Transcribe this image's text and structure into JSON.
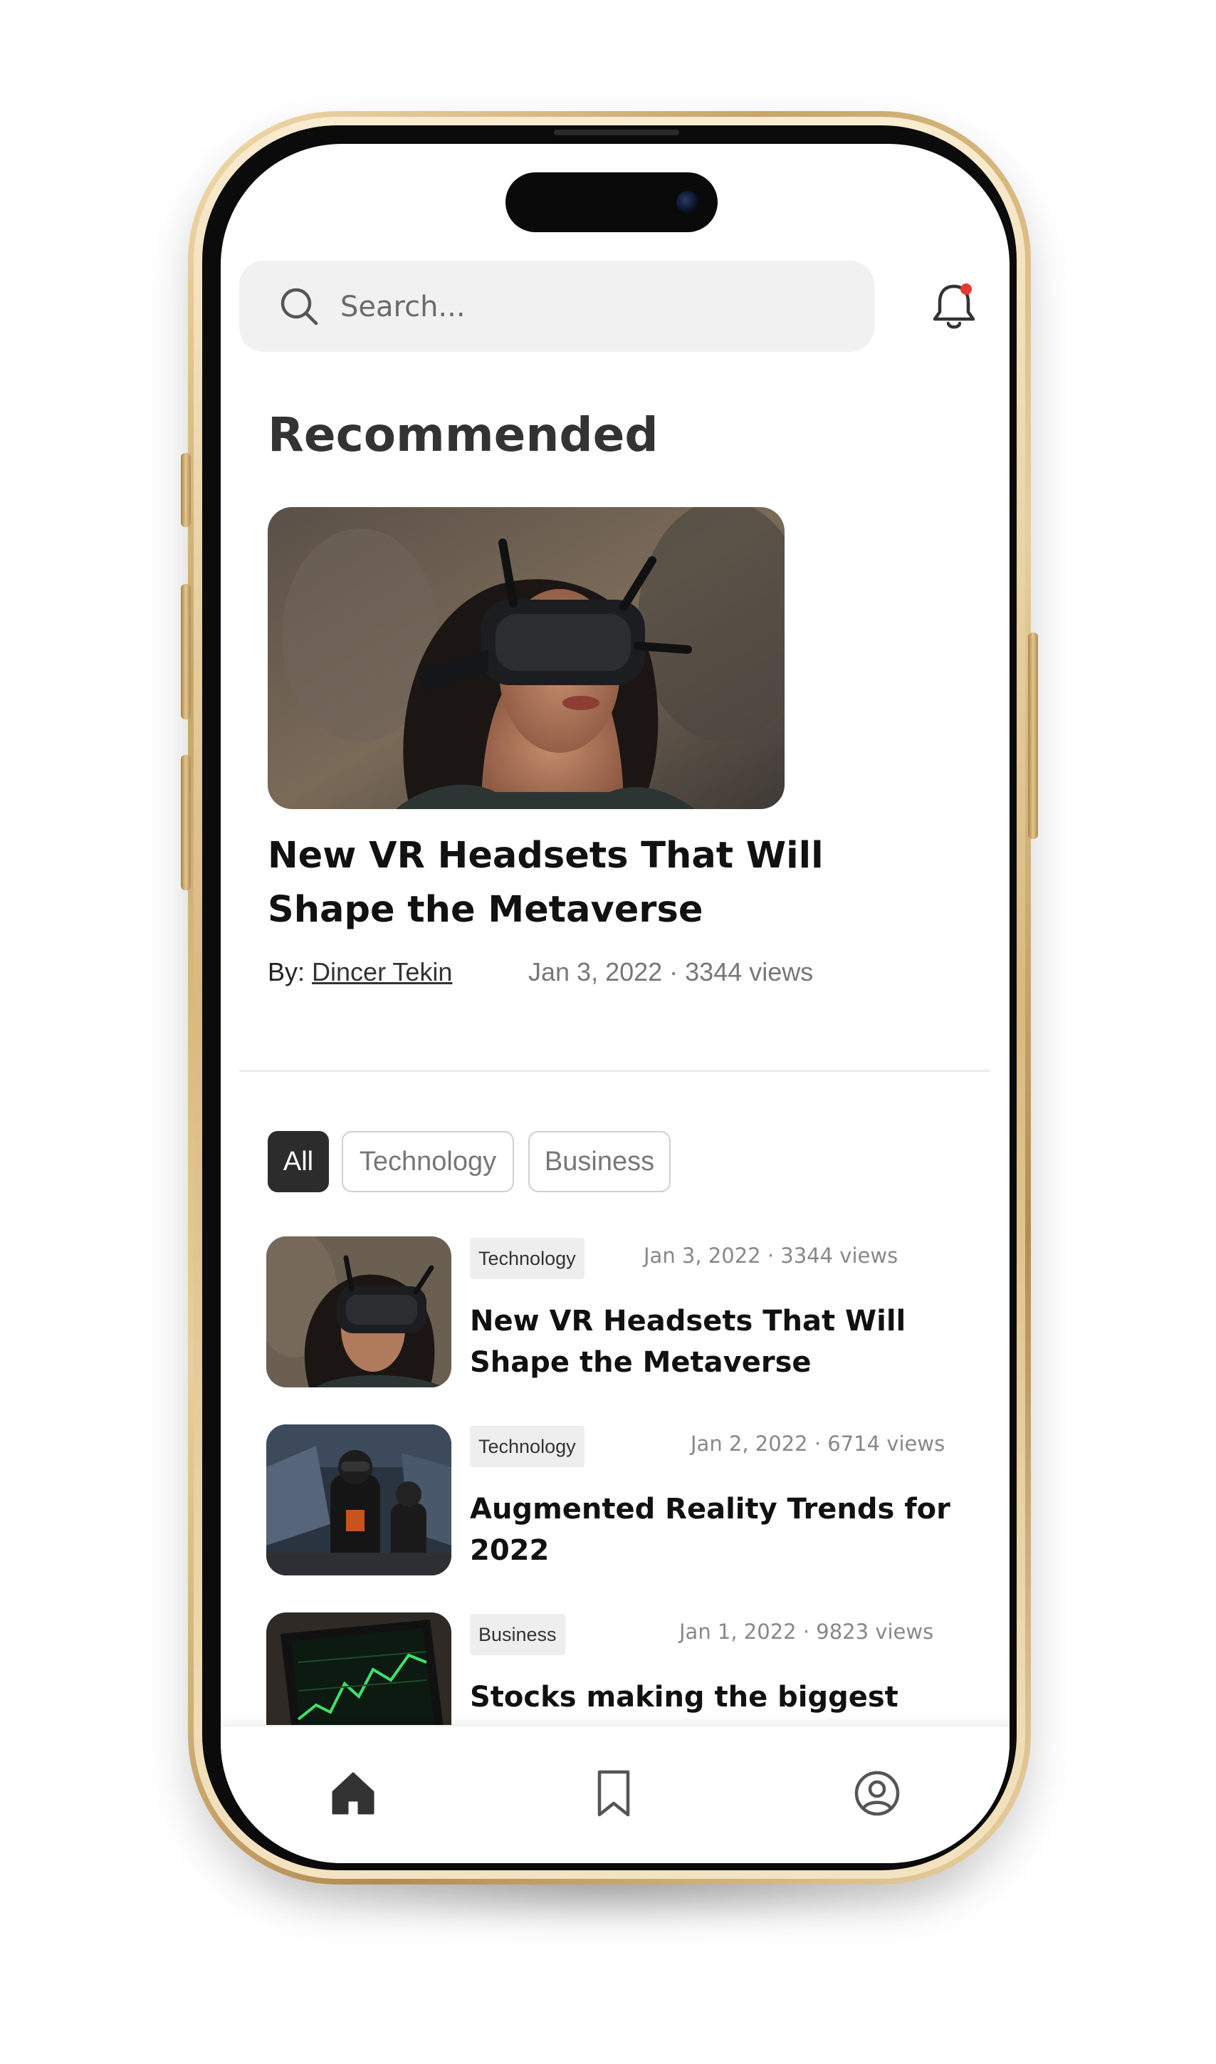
{
  "search": {
    "placeholder": "Search..."
  },
  "notifications": {
    "has_unread": true,
    "dot_color": "#e53935"
  },
  "recommended": {
    "heading": "Recommended",
    "featured": {
      "title": "New VR Headsets That Will Shape the Metaverse",
      "by_label": "By:",
      "author": "Dincer Tekin",
      "date_views": "Jan 3, 2022 · 3344 views",
      "image": "woman-wearing-vr-headset-photo"
    }
  },
  "filters": {
    "chips": [
      {
        "label": "All",
        "active": true
      },
      {
        "label": "Technology",
        "active": false
      },
      {
        "label": "Business",
        "active": false
      }
    ]
  },
  "articles": [
    {
      "category": "Technology",
      "date_views": "Jan 3, 2022 · 3344 views",
      "title": "New VR Headsets That Will Shape the Metaverse",
      "image": "woman-wearing-vr-headset-photo"
    },
    {
      "category": "Technology",
      "date_views": "Jan 2, 2022 · 6714 views",
      "title": "Augmented Reality Trends for 2022",
      "image": "people-in-vr-arena-photo"
    },
    {
      "category": "Business",
      "date_views": "Jan 1, 2022 · 9823 views",
      "title": "Stocks making the biggest moves midday: Tesla...",
      "image": "stock-chart-phone-photo"
    }
  ],
  "bottom_nav": {
    "items": [
      {
        "name": "home",
        "icon": "home-icon",
        "active": true
      },
      {
        "name": "bookmarks",
        "icon": "bookmark-icon",
        "active": false
      },
      {
        "name": "profile",
        "icon": "user-circle-icon",
        "active": false
      }
    ]
  },
  "colors": {
    "accent_dark": "#2c2c2c",
    "frame_gold": "#c9a467"
  }
}
